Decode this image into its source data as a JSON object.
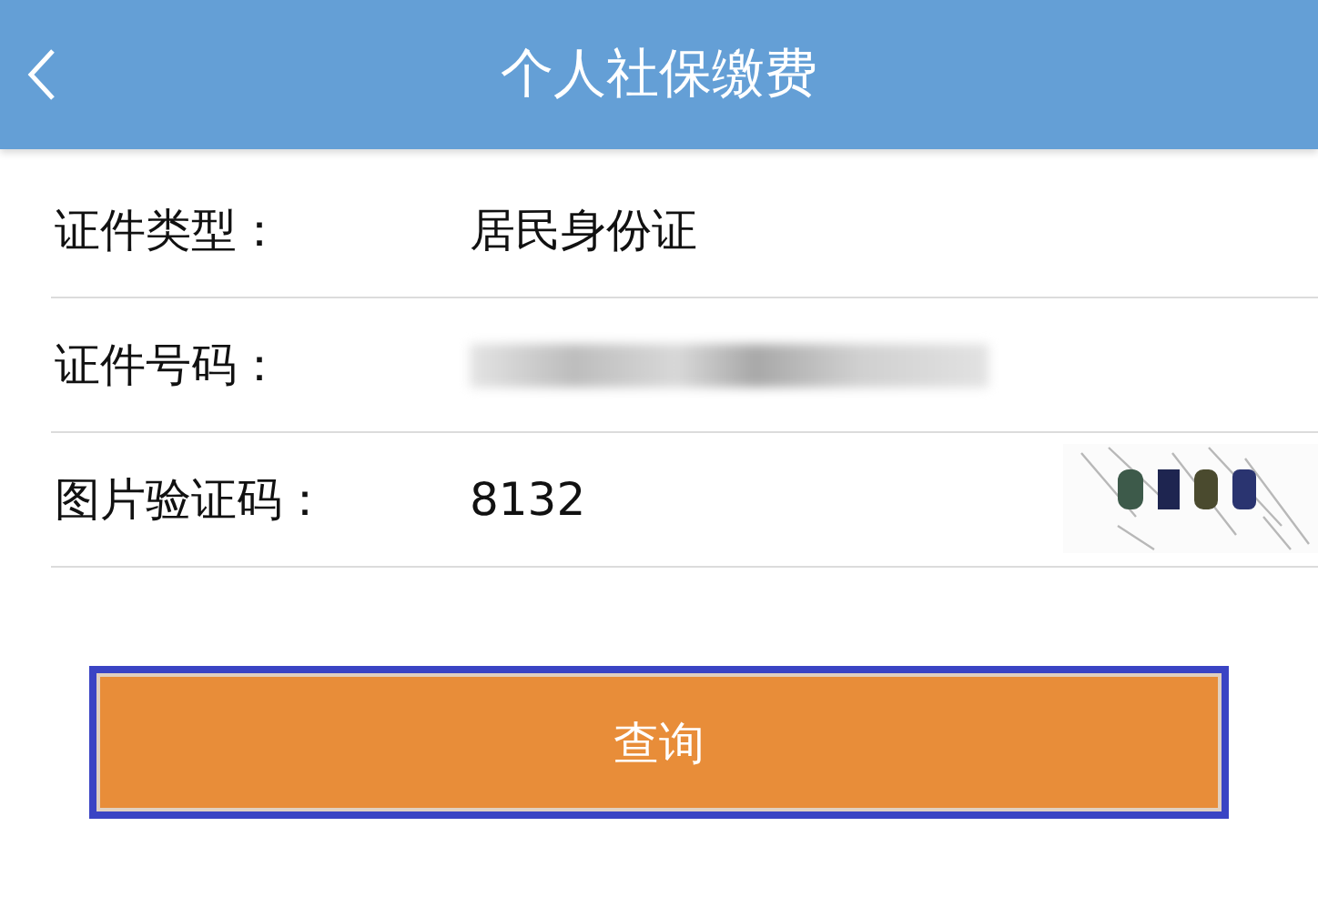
{
  "header": {
    "title": "个人社保缴费"
  },
  "rows": [
    {
      "kind": "text",
      "label": "证件类型：",
      "value": "居民身份证"
    },
    {
      "kind": "redacted",
      "label": "证件号码："
    },
    {
      "kind": "captcha",
      "label": "图片验证码：",
      "value": "8132"
    }
  ],
  "query_button": {
    "label": "查询",
    "focused": true
  }
}
